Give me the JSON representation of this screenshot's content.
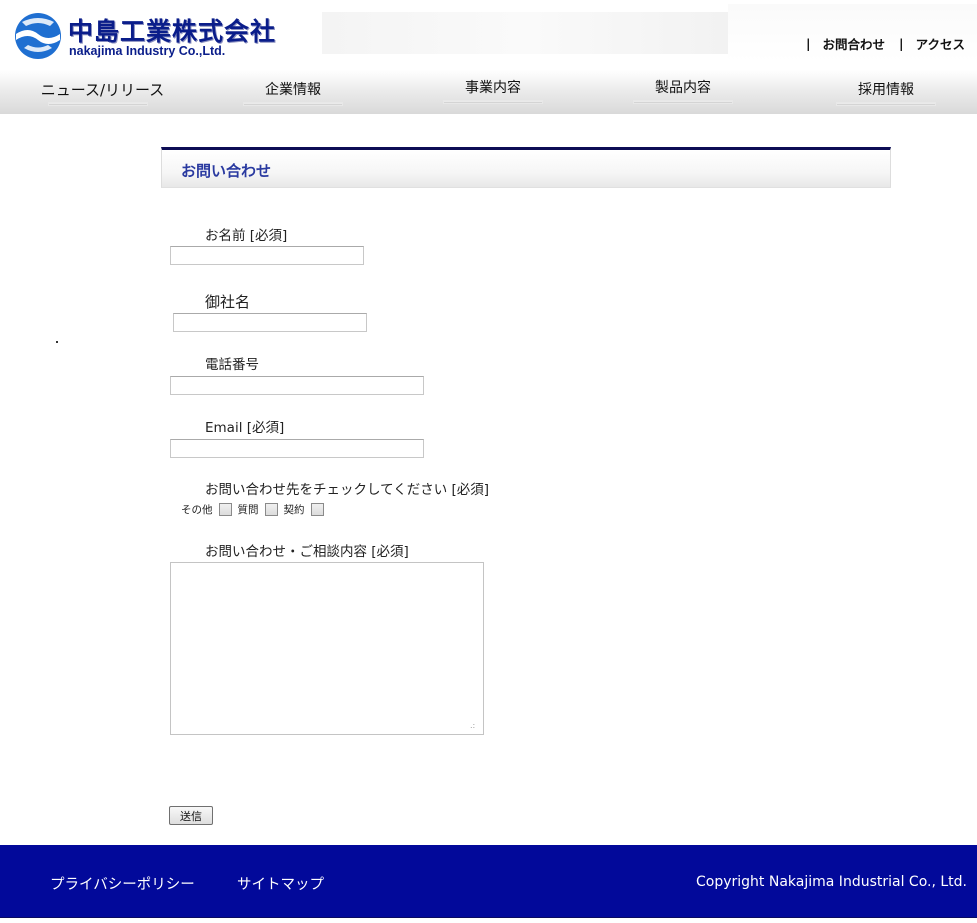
{
  "header": {
    "company_name_jp": "中島工業株式会社",
    "company_name_en": "nakajima Industry Co.,Ltd.",
    "links": [
      {
        "label": "お問合わせ"
      },
      {
        "label": "アクセス"
      }
    ],
    "separator": "|"
  },
  "nav": {
    "items": [
      {
        "label": "ニュース/リリース"
      },
      {
        "label": "企業情報"
      },
      {
        "label": "事業内容"
      },
      {
        "label": "製品内容"
      },
      {
        "label": "採用情報"
      }
    ]
  },
  "page": {
    "title": "お問い合わせ"
  },
  "form": {
    "name_label": "お名前 [必須]",
    "name_value": "",
    "company_label": "御社名",
    "company_value": "",
    "phone_label": "電話番号",
    "phone_value": "",
    "email_label": "Email [必須]",
    "email_value": "",
    "inquiry_type_label": "お問い合わせ先をチェックしてください [必須]",
    "inquiry_options": [
      {
        "label": "その他",
        "checked": false
      },
      {
        "label": "質問",
        "checked": false
      },
      {
        "label": "契約",
        "checked": false
      }
    ],
    "message_label": "お問い合わせ・ご相談内容 [必須]",
    "message_value": "",
    "submit_label": "送信"
  },
  "footer": {
    "privacy_label": "プライバシーポリシー",
    "sitemap_label": "サイトマップ",
    "copyright": "Copyright  Nakajima Industrial Co., Ltd."
  },
  "colors": {
    "brand_navy": "#0a1d8a",
    "footer_bg": "#02099a",
    "title_text": "#2a3aa0"
  }
}
